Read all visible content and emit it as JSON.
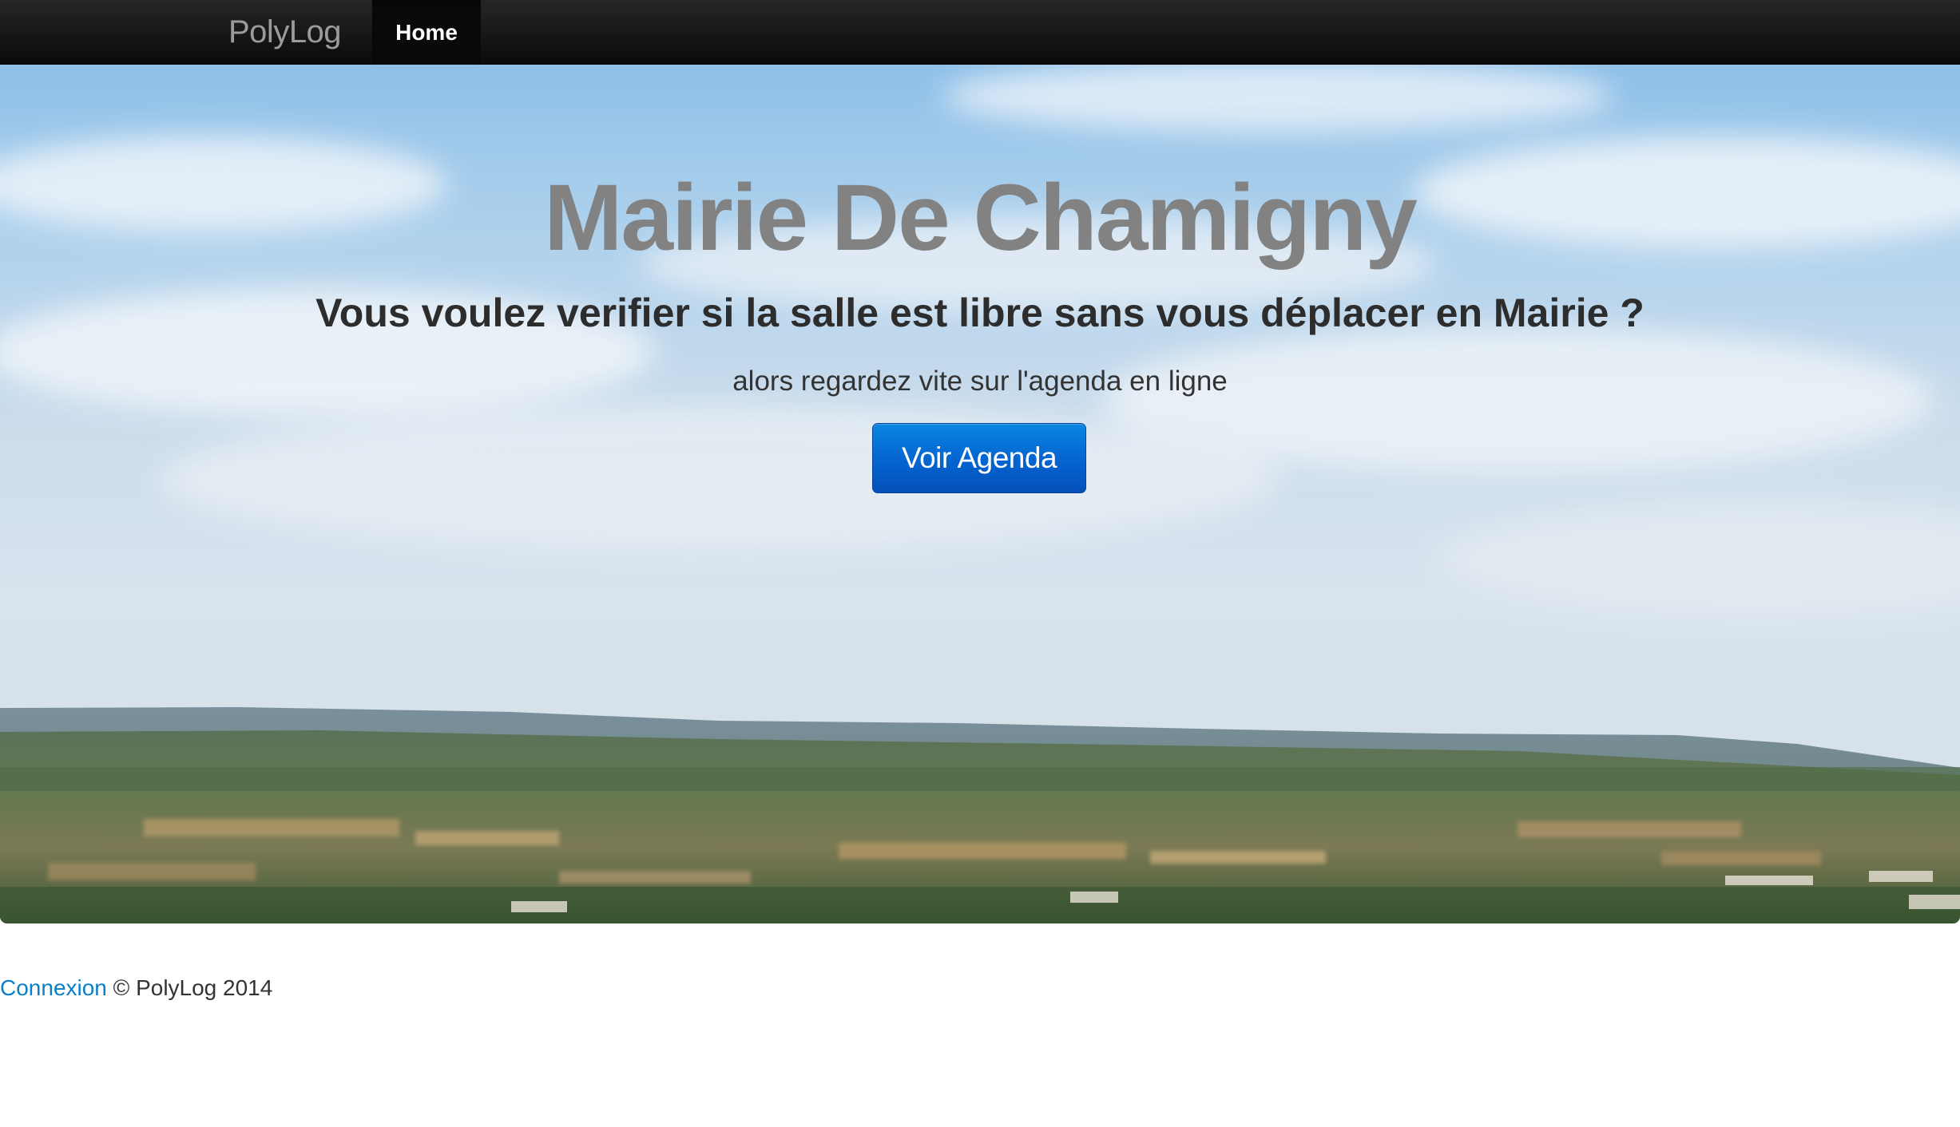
{
  "navbar": {
    "brand": "PolyLog",
    "items": [
      {
        "label": "Home",
        "active": true
      }
    ],
    "background": "#151515"
  },
  "hero": {
    "title": "Mairie De Chamigny",
    "subtitle": "Vous voulez verifier si la salle est libre sans vous déplacer en Mairie ?",
    "text": "alors regardez vite sur l'agenda en ligne",
    "button_label": "Voir Agenda",
    "button_color": "#0466d2",
    "background_image": "landscape-sky-photo"
  },
  "footer": {
    "link_label": "Connexion",
    "copyright": "© PolyLog 2014",
    "link_color": "#0a7fc8"
  }
}
